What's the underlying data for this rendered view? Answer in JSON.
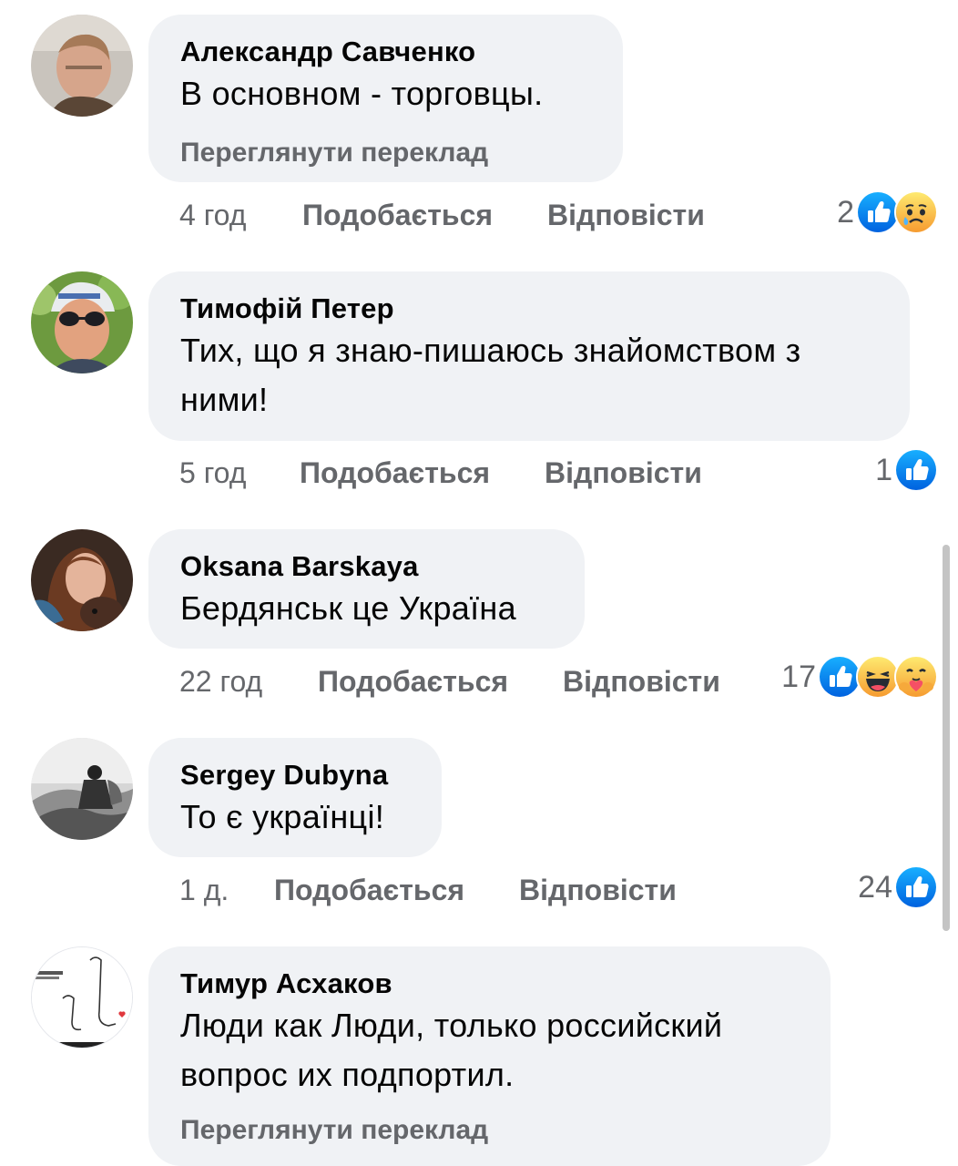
{
  "comments": [
    {
      "author": "Александр Савченко",
      "text": "В основном - торговцы.",
      "translate": "Переглянути переклад",
      "time": "4 год",
      "like": "Подобається",
      "reply": "Відповісти",
      "reaction_count": "2",
      "reactions": [
        "like-icon",
        "sad-icon"
      ]
    },
    {
      "author": "Тимофій Петер",
      "text_lines": [
        "Тих, що я знаю-пишаюсь знайомством з",
        "ними!"
      ],
      "time": "5 год",
      "like": "Подобається",
      "reply": "Відповісти",
      "reaction_count": "1",
      "reactions": [
        "like-icon"
      ]
    },
    {
      "author": "Oksana Barskaya",
      "text": "Бердянськ це Україна",
      "time": "22 год",
      "like": "Подобається",
      "reply": "Відповісти",
      "reaction_count": "17",
      "reactions": [
        "like-icon",
        "haha-icon",
        "care-icon"
      ]
    },
    {
      "author": "Sergey Dubyna",
      "text": "То є українці!",
      "time": "1 д.",
      "like": "Подобається",
      "reply": "Відповісти",
      "reaction_count": "24",
      "reactions": [
        "like-icon"
      ]
    },
    {
      "author": "Тимур Асхаков",
      "text_lines": [
        "Люди как Люди, только российский",
        "вопрос их подпортил."
      ],
      "translate": "Переглянути переклад"
    }
  ],
  "colors": {
    "bubble": "#f0f2f5",
    "secondary_text": "#65676b",
    "like_blue": "#1877f2",
    "emoji_yellow": "#f7b125"
  }
}
